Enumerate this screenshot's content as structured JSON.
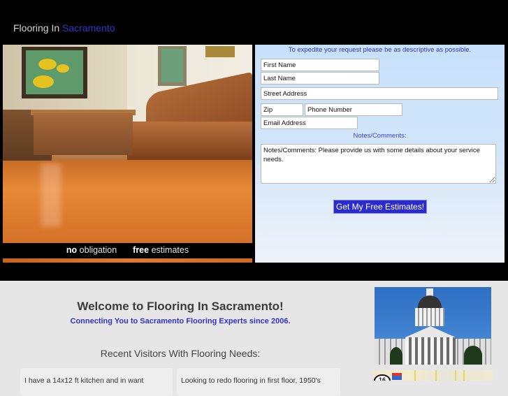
{
  "header": {
    "title_prefix": "Flooring In",
    "title_city": "Sacramento"
  },
  "hero": {
    "image_alt": "Living room with hardwood floor, leather sofa and coffee table",
    "tagline": {
      "no_bold": "no",
      "no_rest": "obligation",
      "free_bold": "free",
      "free_rest": "estimates"
    }
  },
  "form": {
    "intro": "To expedite your request please be as descriptive as possible.",
    "fields": {
      "first_name": "First Name",
      "last_name": "Last Name",
      "street_address": "Street Address",
      "zip": "Zip",
      "phone": "Phone Number",
      "email": "Email Address"
    },
    "notes_label": "Notes/Comments:",
    "notes_value": "Notes/Comments: Please provide us with some details about your service needs.",
    "submit_label": "Get My Free Estimates!"
  },
  "main": {
    "welcome_title": "Welcome to Flooring In Sacramento!",
    "welcome_subtitle": "Connecting You to Sacramento Flooring Experts since 2006.",
    "recent_title": "Recent Visitors With Flooring Needs:",
    "visitors": [
      {
        "text": "I have a 14x12 ft kitchen and in want"
      },
      {
        "text": "Looking to redo flooring in first floor, 1950's"
      }
    ]
  },
  "sidebar": {
    "photo_alt": "California State Capitol building",
    "map_route_number": "16"
  },
  "colors": {
    "accent_blue": "#3030cc",
    "button_blue": "#2b2bcc",
    "form_bg": "#c7e0fb",
    "page_bg": "#e6e6e6"
  }
}
